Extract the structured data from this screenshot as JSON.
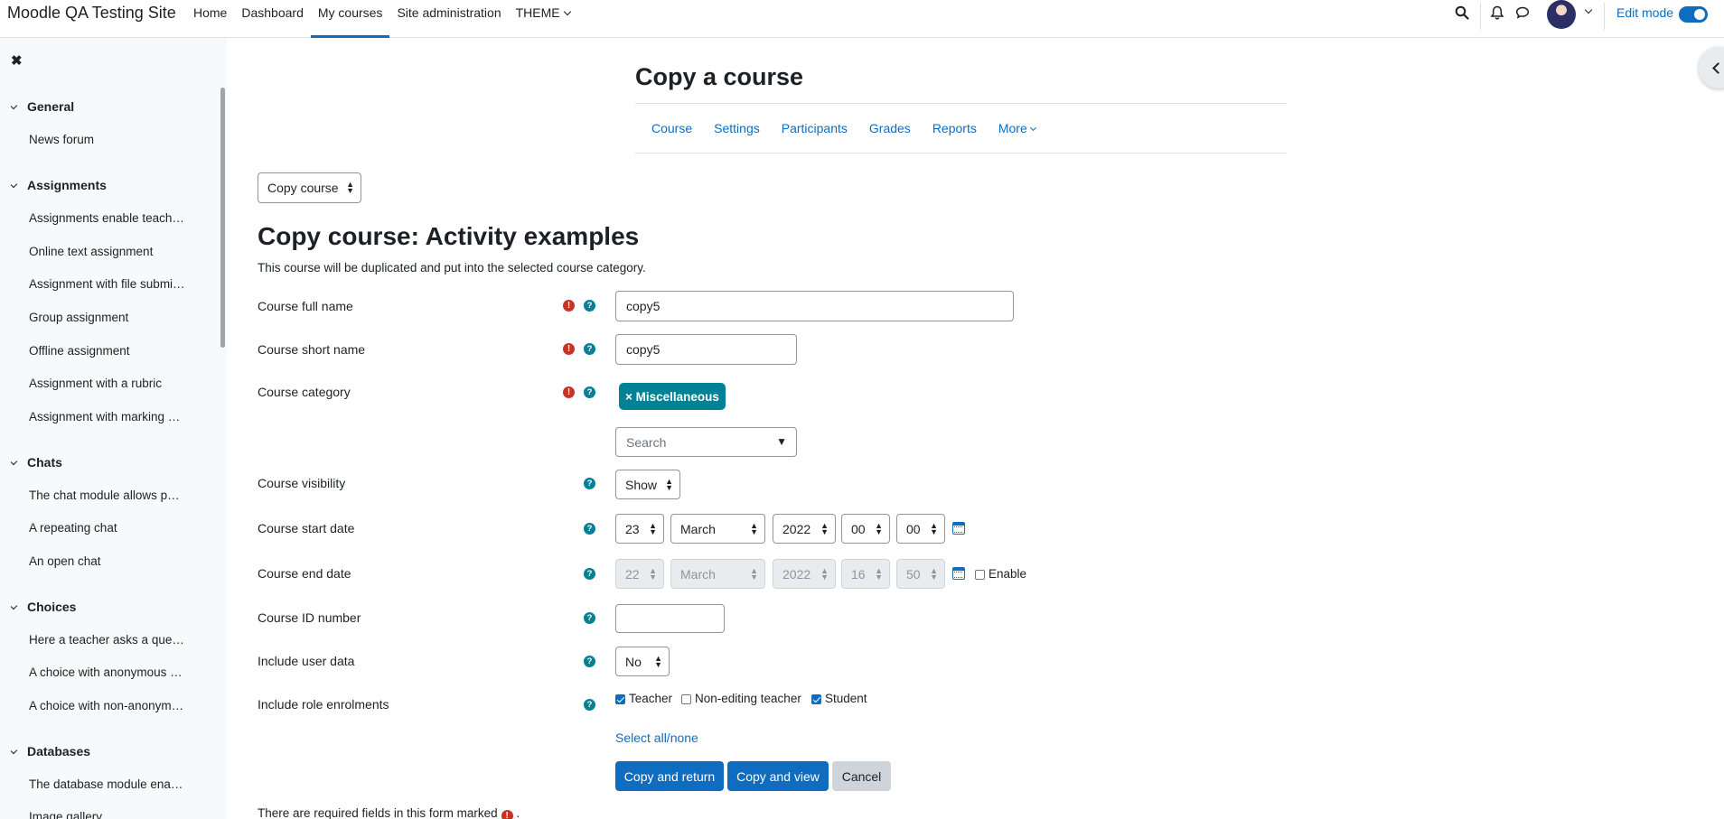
{
  "site": {
    "brand": "Moodle QA Testing Site"
  },
  "topnav": {
    "items": [
      {
        "label": "Home"
      },
      {
        "label": "Dashboard"
      },
      {
        "label": "My courses"
      },
      {
        "label": "Site administration"
      },
      {
        "label": "THEME"
      }
    ],
    "active": "My courses",
    "edit_mode_label": "Edit mode",
    "edit_mode_on": true
  },
  "course_index": {
    "sections": [
      {
        "title": "General",
        "items": [
          "News forum"
        ]
      },
      {
        "title": "Assignments",
        "items": [
          "Assignments enable teach…",
          "Online text assignment",
          "Assignment with file submi…",
          "Group assignment",
          "Offline assignment",
          "Assignment with a rubric",
          "Assignment with marking …"
        ]
      },
      {
        "title": "Chats",
        "items": [
          "The chat module allows p…",
          "A repeating chat",
          "An open chat"
        ]
      },
      {
        "title": "Choices",
        "items": [
          "Here a teacher asks a que…",
          "A choice with anonymous …",
          "A choice with non-anonym…"
        ]
      },
      {
        "title": "Databases",
        "items": [
          "The database module ena…",
          "Image gallery"
        ]
      }
    ]
  },
  "page": {
    "title": "Copy a course",
    "secondary_nav": [
      "Course",
      "Settings",
      "Participants",
      "Grades",
      "Reports",
      "More"
    ],
    "action_select": "Copy course"
  },
  "form": {
    "heading": "Copy course: Activity examples",
    "description": "This course will be duplicated and put into the selected course category.",
    "full_name": {
      "label": "Course full name",
      "value": "copy5"
    },
    "short_name": {
      "label": "Course short name",
      "value": "copy5"
    },
    "category": {
      "label": "Course category",
      "selected": "× Miscellaneous",
      "search_placeholder": "Search"
    },
    "visibility": {
      "label": "Course visibility",
      "value": "Show"
    },
    "start_date": {
      "label": "Course start date",
      "day": "23",
      "month": "March",
      "year": "2022",
      "hour": "00",
      "minute": "00"
    },
    "end_date": {
      "label": "Course end date",
      "day": "22",
      "month": "March",
      "year": "2022",
      "hour": "16",
      "minute": "50",
      "enable_label": "Enable",
      "enabled": false
    },
    "id_number": {
      "label": "Course ID number",
      "value": ""
    },
    "user_data": {
      "label": "Include user data",
      "value": "No"
    },
    "role_enrolments": {
      "label": "Include role enrolments",
      "roles": [
        {
          "label": "Teacher",
          "checked": true
        },
        {
          "label": "Non-editing teacher",
          "checked": false
        },
        {
          "label": "Student",
          "checked": true
        }
      ],
      "select_all": "Select all/none"
    },
    "buttons": {
      "copy_return": "Copy and return",
      "copy_view": "Copy and view",
      "cancel": "Cancel"
    },
    "required_note": "There are required fields in this form marked",
    "required_note_end": "."
  }
}
